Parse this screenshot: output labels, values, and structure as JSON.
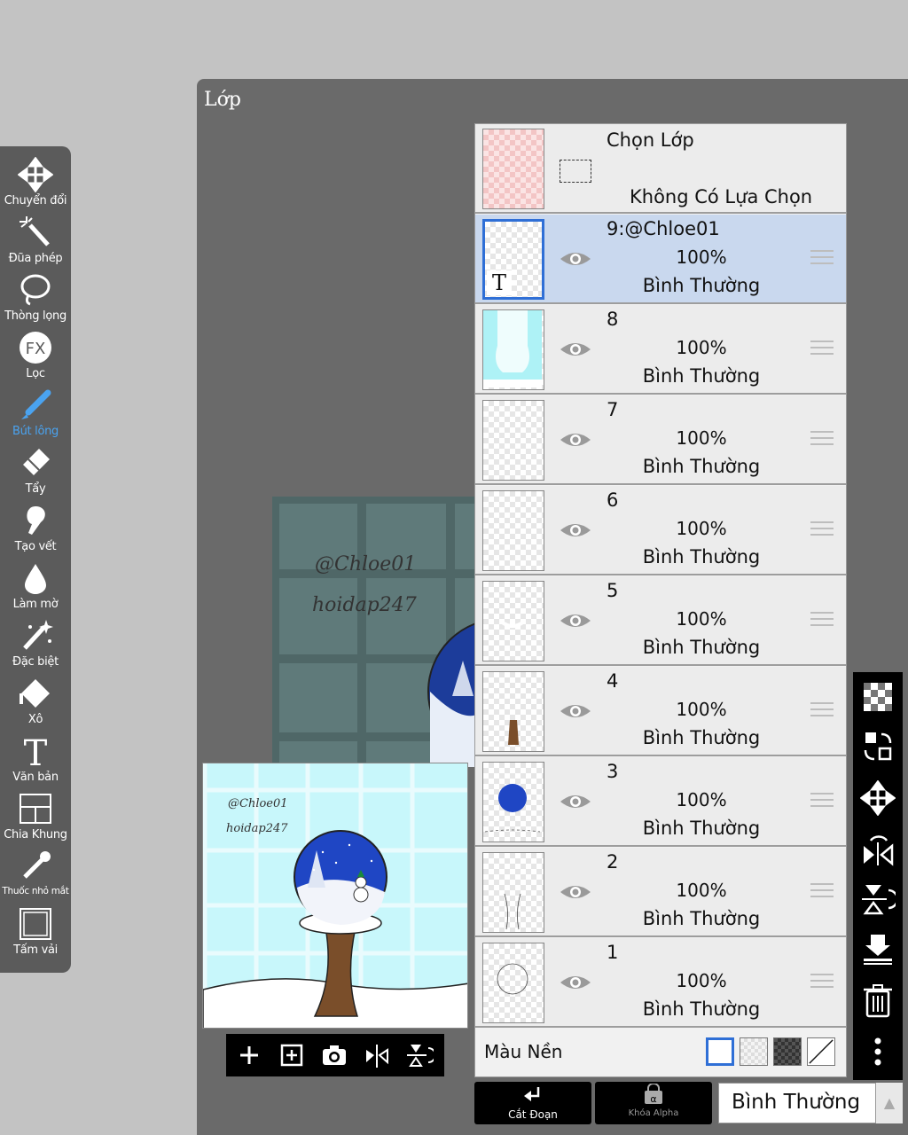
{
  "panel": {
    "title": "Lớp"
  },
  "toolbar": {
    "tools": [
      {
        "label": "Chuyển đổi",
        "icon": "move-icon"
      },
      {
        "label": "Đũa phép",
        "icon": "magic-wand-icon"
      },
      {
        "label": "Thòng lọng",
        "icon": "lasso-icon"
      },
      {
        "label": "Lọc",
        "icon": "fx-icon"
      },
      {
        "label": "Bút lông",
        "icon": "brush-icon",
        "active": true
      },
      {
        "label": "Tẩy",
        "icon": "eraser-icon"
      },
      {
        "label": "Tạo vết",
        "icon": "smudge-icon"
      },
      {
        "label": "Làm mờ",
        "icon": "blur-drop-icon"
      },
      {
        "label": "Đặc biệt",
        "icon": "special-wand-icon"
      },
      {
        "label": "Xô",
        "icon": "bucket-icon"
      },
      {
        "label": "Văn bản",
        "icon": "text-icon"
      },
      {
        "label": "Chia Khung",
        "icon": "frame-divider-icon"
      },
      {
        "label": "Thuốc nhỏ mắt",
        "icon": "eyedropper-icon"
      },
      {
        "label": "Tấm vải",
        "icon": "canvas-icon"
      }
    ]
  },
  "canvas": {
    "watermark1": "@Chloe01",
    "watermark2": "hoidap247"
  },
  "preview": {
    "watermark1": "@Chloe01",
    "watermark2": "hoidap247"
  },
  "selection": {
    "title": "Chọn Lớp",
    "status": "Không Có Lựa Chọn"
  },
  "layers": [
    {
      "name": "9:@Chloe01",
      "opacity": "100%",
      "mode": "Bình Thường",
      "selected": true,
      "text_layer": true
    },
    {
      "name": "8",
      "opacity": "100%",
      "mode": "Bình Thường"
    },
    {
      "name": "7",
      "opacity": "100%",
      "mode": "Bình Thường"
    },
    {
      "name": "6",
      "opacity": "100%",
      "mode": "Bình Thường"
    },
    {
      "name": "5",
      "opacity": "100%",
      "mode": "Bình Thường"
    },
    {
      "name": "4",
      "opacity": "100%",
      "mode": "Bình Thường"
    },
    {
      "name": "3",
      "opacity": "100%",
      "mode": "Bình Thường"
    },
    {
      "name": "2",
      "opacity": "100%",
      "mode": "Bình Thường"
    },
    {
      "name": "1",
      "opacity": "100%",
      "mode": "Bình Thường"
    }
  ],
  "background": {
    "label": "Màu Nền",
    "text_layer_badge": "T"
  },
  "bottom": {
    "cut_label": "Cắt Đoạn",
    "alpha_label": "Khóa Alpha",
    "blend_mode": "Bình Thường"
  },
  "colors": {
    "accent": "#2f6fd6",
    "active_tool": "#4aa3f0",
    "selected_row": "#c9d8ee"
  }
}
